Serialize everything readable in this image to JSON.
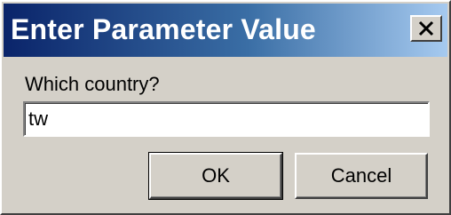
{
  "window": {
    "title": "Enter Parameter Value",
    "close_icon": "close-icon"
  },
  "prompt": {
    "label": "Which country?"
  },
  "input": {
    "value": "tw"
  },
  "buttons": {
    "ok_label": "OK",
    "cancel_label": "Cancel"
  },
  "colors": {
    "titlebar_start": "#0a246a",
    "titlebar_end": "#a6caf0",
    "dialog_face": "#d4d0c8"
  }
}
